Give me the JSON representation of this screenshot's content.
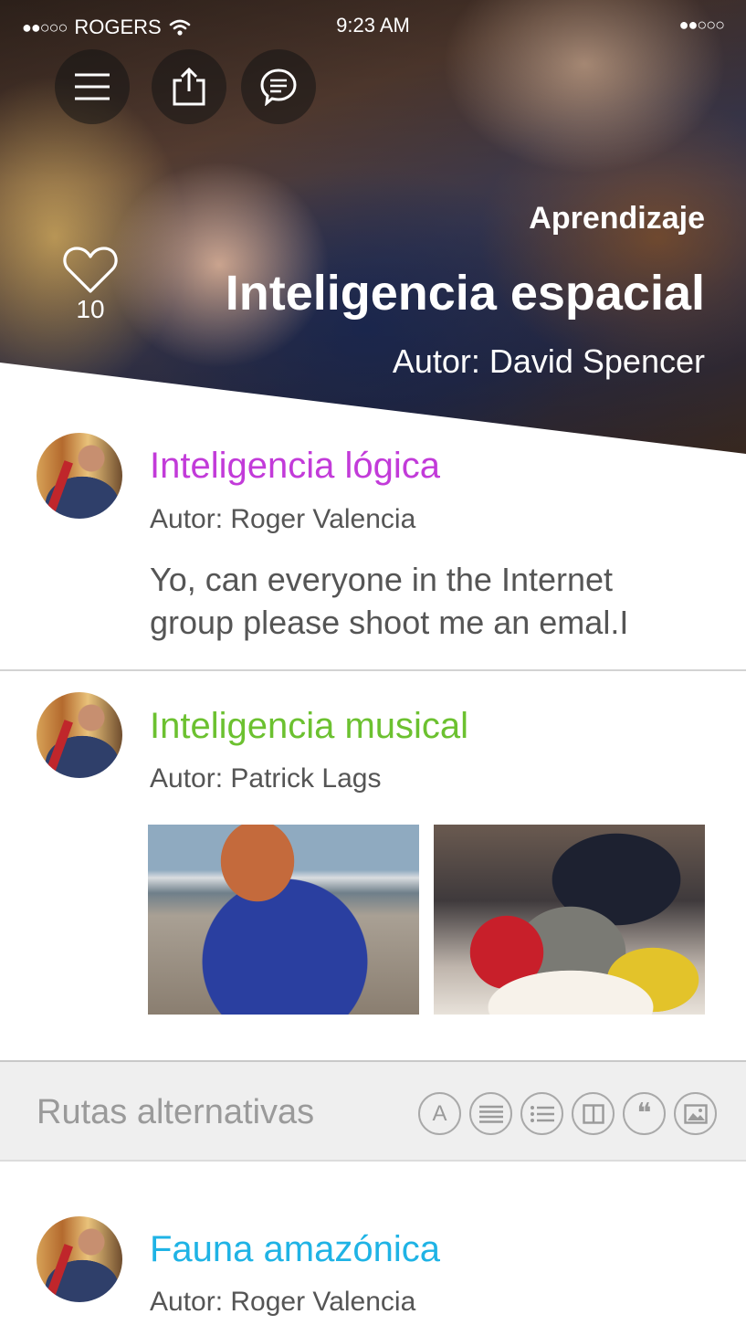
{
  "status_bar": {
    "signal_left": "●●○○○",
    "carrier": "ROGERS",
    "wifi_icon": "wifi-icon",
    "time": "9:23 AM",
    "signal_right": "●●○○○"
  },
  "hero": {
    "category": "Aprendizaje",
    "title": "Inteligencia espacial",
    "author": "Autor: David Spencer",
    "like_count": "10",
    "actions": [
      "menu-icon",
      "share-icon",
      "chat-icon"
    ]
  },
  "posts": [
    {
      "title": "Inteligencia lógica",
      "author": "Autor: Roger Valencia",
      "body": "Yo, can everyone in the Internet group please shoot me an emal.I",
      "title_color": "#c23bd9"
    },
    {
      "title": "Inteligencia musical",
      "author": "Autor: Patrick Lags",
      "title_color": "#6cc130"
    },
    {
      "title": "Fauna amazónica",
      "author": "Autor: Roger Valencia",
      "title_color": "#1fb3e5"
    }
  ],
  "alternatives": {
    "title": "Rutas alternativas",
    "icons": [
      "text-icon",
      "paragraph-icon",
      "list-icon",
      "columns-icon",
      "quote-icon",
      "image-icon"
    ],
    "text_icon_label": "A",
    "quote_icon_label": "❝"
  }
}
